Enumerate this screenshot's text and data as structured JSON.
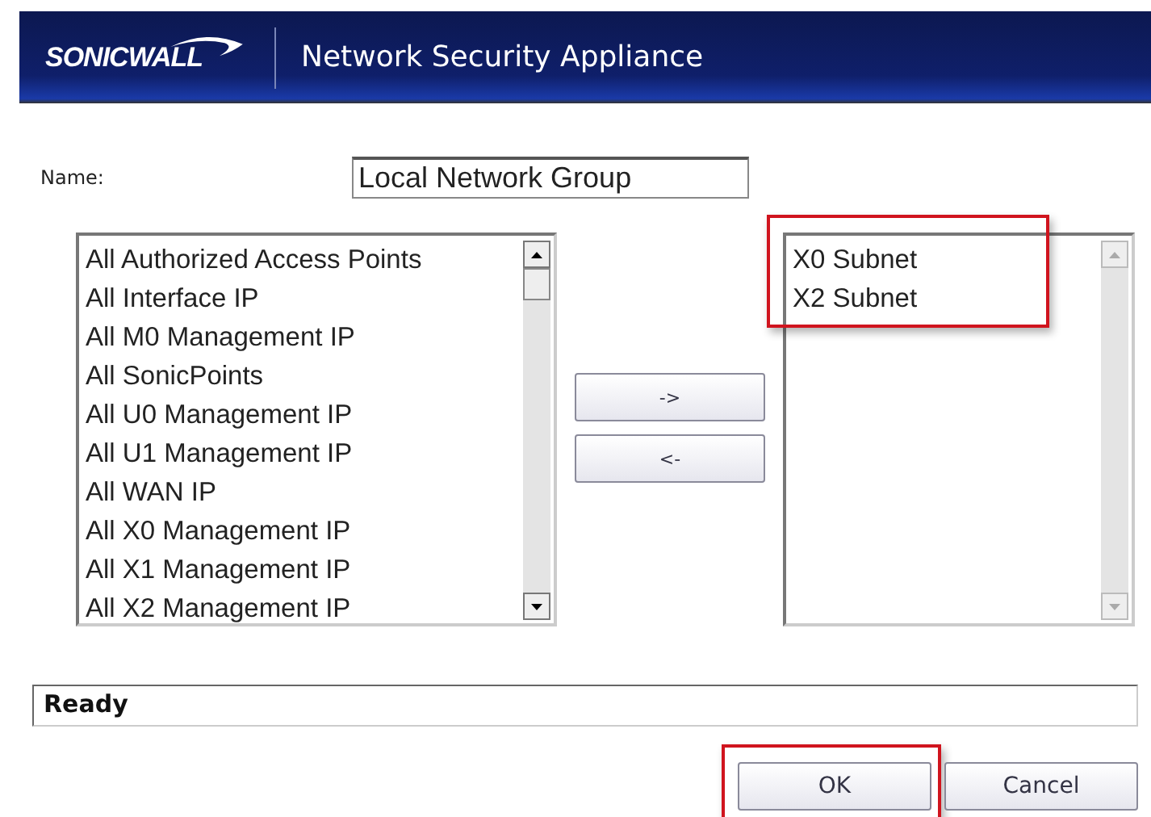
{
  "header": {
    "logo": "SONICWALL",
    "title": "Network Security Appliance"
  },
  "name_field": {
    "label": "Name:",
    "value": "Local Network Group"
  },
  "available_list": {
    "items": [
      "All Authorized Access Points",
      "All Interface IP",
      "All M0 Management IP",
      "All SonicPoints",
      "All U0 Management IP",
      "All U1 Management IP",
      "All WAN IP",
      "All X0 Management IP",
      "All X1 Management IP",
      "All X2 Management IP"
    ]
  },
  "move_buttons": [
    "->",
    "<-"
  ],
  "member_list": {
    "items": [
      "X0 Subnet",
      "X2 Subnet"
    ],
    "highlighted": true
  },
  "status_bar": "Ready",
  "buttons": [
    {
      "label": "OK",
      "highlighted": true
    },
    {
      "label": "Cancel",
      "highlighted": false
    }
  ]
}
